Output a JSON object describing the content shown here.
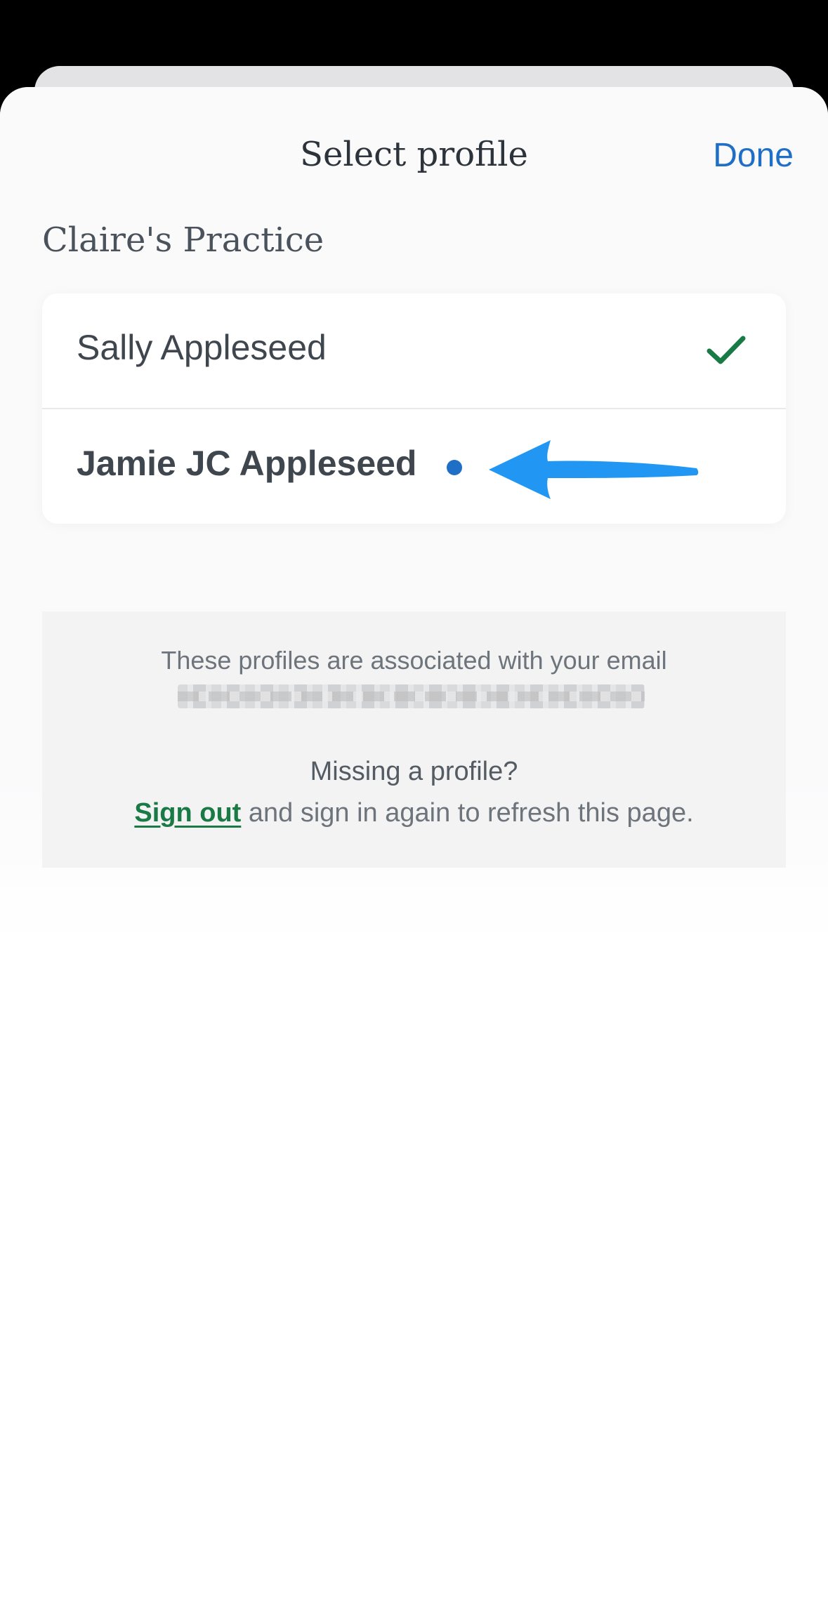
{
  "header": {
    "title": "Select profile",
    "done_label": "Done"
  },
  "practice": {
    "name": "Claire's Practice"
  },
  "profiles": [
    {
      "name": "Sally Appleseed",
      "selected": true,
      "unread": false
    },
    {
      "name": "Jamie JC Appleseed",
      "selected": false,
      "unread": true
    }
  ],
  "info": {
    "associated_text": "These profiles are associated with your email",
    "missing_title": "Missing a profile?",
    "signout_link": "Sign out",
    "signout_suffix": " and sign in again to refresh this page."
  },
  "colors": {
    "accent_blue": "#1f6fc6",
    "check_green": "#1a7a45",
    "annotation_arrow": "#2196f3"
  },
  "icons": {
    "selected": "checkmark-icon",
    "unread": "unread-dot-icon",
    "annotation": "arrow-left-icon"
  }
}
